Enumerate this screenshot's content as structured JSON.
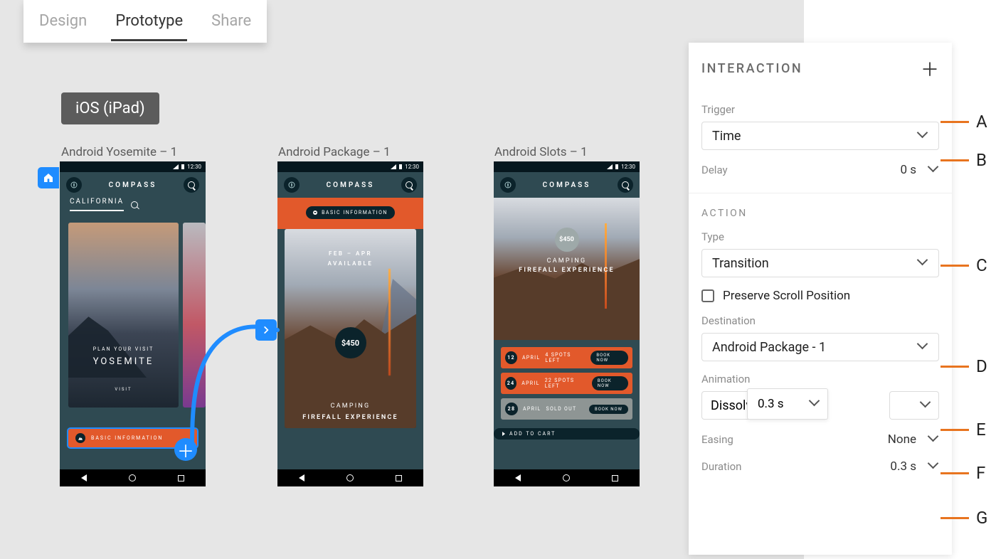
{
  "tabs": {
    "design": "Design",
    "prototype": "Prototype",
    "share": "Share"
  },
  "device_badge": "iOS (iPad)",
  "artboards": {
    "a1": "Android Yosemite – 1",
    "a2": "Android Package – 1",
    "a3": "Android Slots – 1"
  },
  "app": {
    "brand": "COMPASS",
    "time": "12:30",
    "california": "CALIFORNIA",
    "plan": "PLAN YOUR VISIT",
    "yosemite": "YOSEMITE",
    "visit": "VISIT",
    "basic_info": "BASIC INFORMATION",
    "avail_line1": "FEB – APR",
    "avail_line2": "AVAILABLE",
    "price": "$450",
    "camping": "CAMPING",
    "experience": "FIREFALL EXPERIENCE",
    "add_to_cart": "ADD TO CART",
    "slots": [
      {
        "day": "12",
        "month": "APRIL",
        "spots": "4 SPOTS LEFT",
        "btn": "BOOK NOW",
        "gray": false
      },
      {
        "day": "24",
        "month": "APRIL",
        "spots": "22 SPOTS LEFT",
        "btn": "BOOK NOW",
        "gray": false
      },
      {
        "day": "28",
        "month": "APRIL",
        "spots": "SOLD OUT",
        "btn": "BOOK NOW",
        "gray": true
      }
    ]
  },
  "panel": {
    "title": "INTERACTION",
    "trigger_label": "Trigger",
    "trigger_value": "Time",
    "delay_label": "Delay",
    "delay_value": "0 s",
    "action_label": "ACTION",
    "type_label": "Type",
    "type_value": "Transition",
    "preserve": "Preserve Scroll Position",
    "destination_label": "Destination",
    "destination_value": "Android Package - 1",
    "animation_label": "Animation",
    "animation_value": "Dissolve",
    "animation_popup": "0.3 s",
    "easing_label": "Easing",
    "easing_value": "None",
    "duration_label": "Duration",
    "duration_value": "0.3 s"
  },
  "callouts": {
    "a": "A",
    "b": "B",
    "c": "C",
    "d": "D",
    "e": "E",
    "f": "F",
    "g": "G"
  }
}
